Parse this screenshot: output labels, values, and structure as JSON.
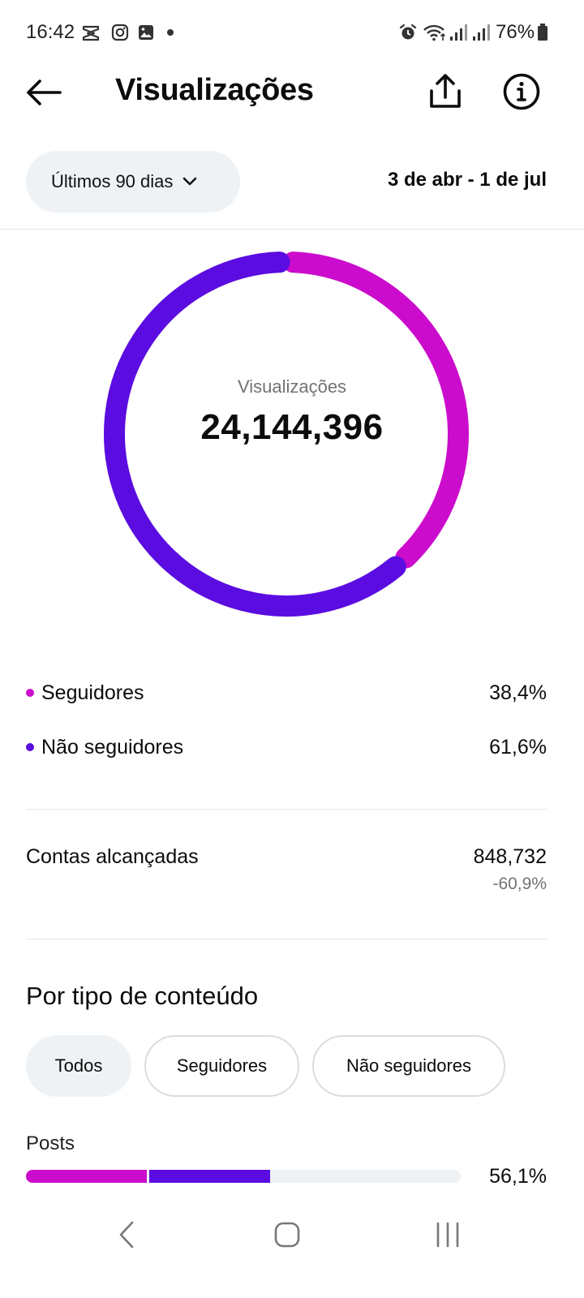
{
  "status_bar": {
    "time": "16:42",
    "battery": "76%",
    "left_icons": [
      "capcut-icon",
      "instagram-icon",
      "gallery-icon"
    ],
    "right_icons": [
      "alarm-icon",
      "wifi-icon",
      "signal-icon",
      "signal-icon",
      "battery-icon"
    ]
  },
  "header": {
    "title": "Visualizações",
    "back_icon": "back-arrow-icon",
    "share_icon": "share-icon",
    "info_icon": "info-icon"
  },
  "filter": {
    "period": "Últimos 90 dias",
    "date_range": "3 de abr - 1 de jul"
  },
  "summary": {
    "label": "Visualizações",
    "total": "24,144,396"
  },
  "chart_data": {
    "type": "pie",
    "categories": [
      "Seguidores",
      "Não seguidores"
    ],
    "values": [
      38.4,
      61.6
    ],
    "colors": [
      "#cc0ccc",
      "#5b0ce0"
    ]
  },
  "legend": [
    {
      "name": "Seguidores",
      "value": "38,4%",
      "color": "#cc0ccc"
    },
    {
      "name": "Não seguidores",
      "value": "61,6%",
      "color": "#5b0ce0"
    }
  ],
  "reach": {
    "label": "Contas alcançadas",
    "value": "848,732",
    "change": "-60,9%"
  },
  "content_type": {
    "title": "Por tipo de conteúdo",
    "tabs": [
      "Todos",
      "Seguidores",
      "Não seguidores"
    ],
    "selected_tab": "Todos",
    "rows": [
      {
        "label": "Posts",
        "value": "56,1%",
        "total_share": 56.1,
        "segment_colors": [
          "#cc0ccc",
          "#5b0ce0"
        ]
      }
    ]
  },
  "nav": {
    "back_icon": "nav-back-icon",
    "home_icon": "nav-home-icon",
    "recents_icon": "nav-recents-icon"
  }
}
